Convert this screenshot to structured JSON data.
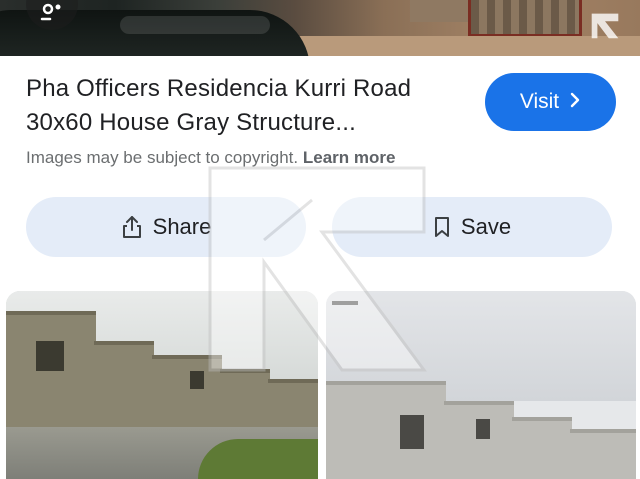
{
  "result": {
    "title_line1": "Pha Officers Residencia Kurri Road",
    "title_line2": "30x60 House Gray Structure...",
    "visit_label": "Visit",
    "copyright_text": "Images may be subject to copyright.",
    "learn_more": "Learn more"
  },
  "actions": {
    "share_label": "Share",
    "save_label": "Save"
  },
  "icons": {
    "lens": "google-lens-icon",
    "share": "share-icon",
    "save": "bookmark-icon",
    "visit_chevron": "chevron-right-icon",
    "watermark": "zameen-logo"
  },
  "colors": {
    "accent": "#1a73e8",
    "pill_bg": "#e4ecf8",
    "text": "#202124",
    "muted": "#6b6e70"
  }
}
